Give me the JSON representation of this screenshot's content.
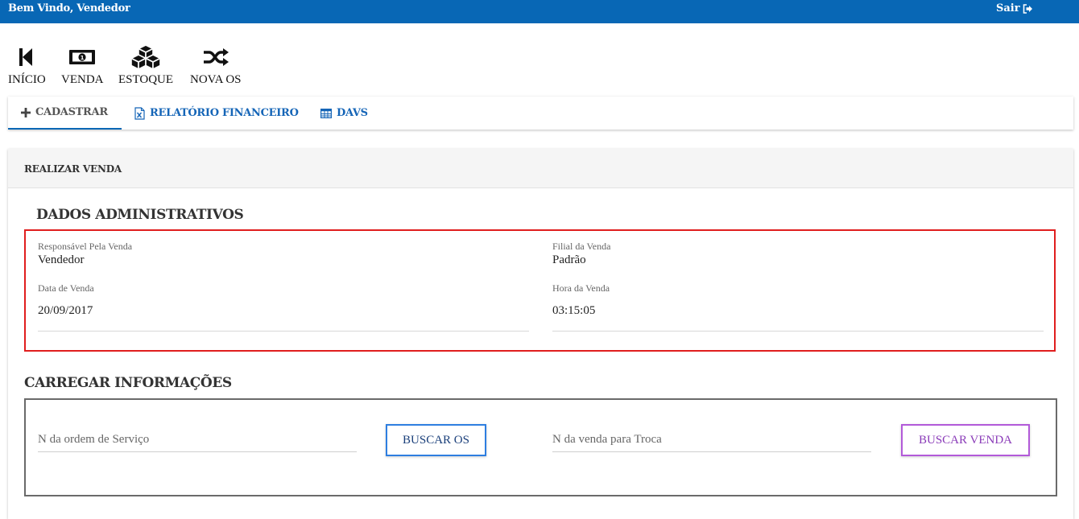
{
  "header": {
    "welcome": "Bem Vindo, Vendedor",
    "logout_label": "Sair"
  },
  "toolbar": {
    "items": [
      {
        "label": "INÍCIO",
        "icon": "skip-back-icon"
      },
      {
        "label": "VENDA",
        "icon": "money-bill-icon"
      },
      {
        "label": "ESTOQUE",
        "icon": "cubes-icon"
      },
      {
        "label": "NOVA OS",
        "icon": "shuffle-icon"
      }
    ]
  },
  "tabs": [
    {
      "label": "CADASTRAR",
      "icon": "plus-icon",
      "active": true
    },
    {
      "label": "RELATÓRIO FINANCEIRO",
      "icon": "excel-file-icon",
      "active": false
    },
    {
      "label": "DAVS",
      "icon": "table-icon",
      "active": false
    }
  ],
  "panel": {
    "title": "REALIZAR VENDA",
    "admin": {
      "title": "DADOS ADMINISTRATIVOS",
      "responsavel_label": "Responsável Pela Venda",
      "responsavel_value": "Vendedor",
      "filial_label": "Filial da Venda",
      "filial_value": "Padrão",
      "data_label": "Data de Venda",
      "data_value": "20/09/2017",
      "hora_label": "Hora da Venda",
      "hora_value": "03:15:05"
    },
    "carregar": {
      "title": "CARREGAR INFORMAÇÕES",
      "os_placeholder": "N da ordem de Serviço",
      "buscar_os_label": "BUSCAR OS",
      "troca_placeholder": "N da venda para Troca",
      "buscar_venda_label": "BUSCAR VENDA"
    }
  },
  "colors": {
    "header_bg": "#0867b5",
    "tab_link": "#1565b7",
    "admin_border": "#e01e1e",
    "buscar_os_border": "#2e7ee0",
    "buscar_venda_border": "#b25ad9"
  }
}
